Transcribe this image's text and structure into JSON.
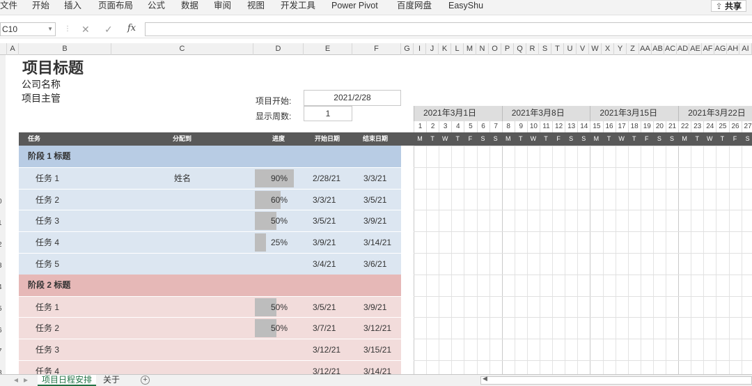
{
  "ribbon": {
    "menu": [
      "文件",
      "开始",
      "插入",
      "页面布局",
      "公式",
      "数据",
      "审阅",
      "视图",
      "开发工具",
      "Power Pivot",
      "百度网盘",
      "EasyShu"
    ],
    "share_label": "共享"
  },
  "formula_bar": {
    "name_box": "C10",
    "cancel_icon": "✕",
    "enter_icon": "✓",
    "fx_label": "fx",
    "content": ""
  },
  "columns": [
    "A",
    "B",
    "C",
    "D",
    "E",
    "F",
    "G",
    "I",
    "J",
    "K",
    "L",
    "M",
    "N",
    "O",
    "P",
    "Q",
    "R",
    "S",
    "T",
    "U",
    "V",
    "W",
    "X",
    "Y",
    "Z",
    "AA",
    "AB",
    "AC",
    "AD",
    "AE",
    "AF",
    "AG",
    "AH",
    "AI"
  ],
  "row_numbers": [
    "0",
    "1",
    "2",
    "3",
    "4",
    "5",
    "6",
    "7",
    "8"
  ],
  "sheet": {
    "title": "项目标题",
    "company": "公司名称",
    "manager": "项目主管",
    "start_label": "项目开始:",
    "start_value": "2021/2/28",
    "weeks_label": "显示周数:",
    "weeks_value": "1"
  },
  "table_header": {
    "task": "任务",
    "assigned": "分配到",
    "progress": "进度",
    "start": "开始日期",
    "end": "结束日期"
  },
  "gantt": {
    "weeks": [
      "2021年3月1日",
      "2021年3月8日",
      "2021年3月15日",
      "2021年3月22日"
    ],
    "day_numbers": [
      "1",
      "2",
      "3",
      "4",
      "5",
      "6",
      "7",
      "8",
      "9",
      "10",
      "11",
      "12",
      "13",
      "14",
      "15",
      "16",
      "17",
      "18",
      "19",
      "20",
      "21",
      "22",
      "23",
      "24",
      "25",
      "26",
      "27"
    ],
    "day_letters": [
      "M",
      "T",
      "W",
      "T",
      "F",
      "S",
      "S",
      "M",
      "T",
      "W",
      "T",
      "F",
      "S",
      "S",
      "M",
      "T",
      "W",
      "T",
      "F",
      "S",
      "S",
      "M",
      "T",
      "W",
      "T",
      "F",
      "S"
    ],
    "chart_start": "2021/2/26",
    "colors": {
      "done": "#a6a6a6",
      "remaining": "#8064a2",
      "phase1": "#b8cce4",
      "phase1_row": "#dce6f1",
      "phase2": "#e6b8b7",
      "phase2_row": "#f2dcdb",
      "header": "#595959"
    }
  },
  "rows": [
    {
      "type": "phase",
      "label": "阶段 1 标题",
      "phase": 1
    },
    {
      "type": "task",
      "phase": 1,
      "task": "任务 1",
      "assigned": "姓名",
      "progress": "90%",
      "pct": 0.9,
      "start": "2/28/21",
      "end": "3/3/21",
      "s": "2021-02-28",
      "e": "2021-03-03"
    },
    {
      "type": "task",
      "phase": 1,
      "task": "任务 2",
      "assigned": "",
      "progress": "60%",
      "pct": 0.6,
      "start": "3/3/21",
      "end": "3/5/21",
      "s": "2021-03-03",
      "e": "2021-03-05"
    },
    {
      "type": "task",
      "phase": 1,
      "task": "任务 3",
      "assigned": "",
      "progress": "50%",
      "pct": 0.5,
      "start": "3/5/21",
      "end": "3/9/21",
      "s": "2021-03-05",
      "e": "2021-03-09"
    },
    {
      "type": "task",
      "phase": 1,
      "task": "任务 4",
      "assigned": "",
      "progress": "25%",
      "pct": 0.25,
      "start": "3/9/21",
      "end": "3/14/21",
      "s": "2021-03-09",
      "e": "2021-03-14"
    },
    {
      "type": "task",
      "phase": 1,
      "task": "任务 5",
      "assigned": "",
      "progress": "",
      "pct": 0,
      "start": "3/4/21",
      "end": "3/6/21",
      "s": "2021-03-04",
      "e": "2021-03-06"
    },
    {
      "type": "phase",
      "label": "阶段 2 标题",
      "phase": 2
    },
    {
      "type": "task",
      "phase": 2,
      "task": "任务 1",
      "assigned": "",
      "progress": "50%",
      "pct": 0.5,
      "start": "3/5/21",
      "end": "3/9/21",
      "s": "2021-03-05",
      "e": "2021-03-09"
    },
    {
      "type": "task",
      "phase": 2,
      "task": "任务 2",
      "assigned": "",
      "progress": "50%",
      "pct": 0.5,
      "start": "3/7/21",
      "end": "3/12/21",
      "s": "2021-03-07",
      "e": "2021-03-12"
    },
    {
      "type": "task",
      "phase": 2,
      "task": "任务 3",
      "assigned": "",
      "progress": "",
      "pct": 0,
      "start": "3/12/21",
      "end": "3/15/21",
      "s": "2021-03-12",
      "e": "2021-03-15"
    },
    {
      "type": "task",
      "phase": 2,
      "task": "任务 4",
      "assigned": "",
      "progress": "",
      "pct": 0,
      "start": "3/12/21",
      "end": "3/14/21",
      "s": "2021-03-12",
      "e": "2021-03-14"
    }
  ],
  "tabs": {
    "active": "项目日程安排",
    "other": "关于",
    "add": "+"
  }
}
